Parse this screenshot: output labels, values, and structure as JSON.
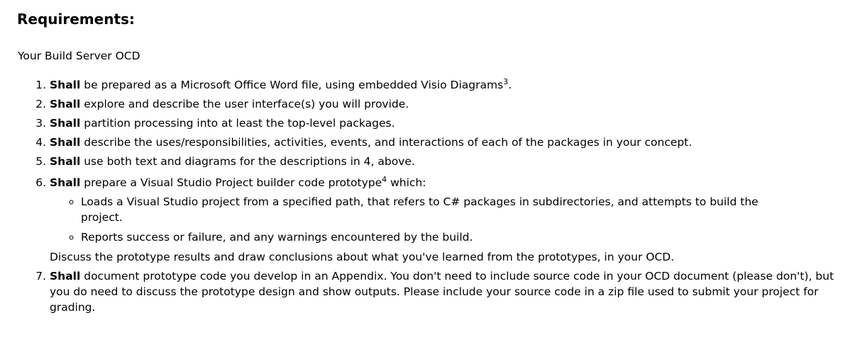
{
  "heading": "Requirements:",
  "intro": "Your Build Server OCD",
  "keyword": "Shall",
  "items": [
    {
      "text": " be prepared as a Microsoft Office Word file, using embedded Visio Diagrams",
      "sup": "3",
      "tail": "."
    },
    {
      "text": " explore and describe the user interface(s) you will provide."
    },
    {
      "text": " partition processing into at least the top-level packages."
    },
    {
      "text": " describe the uses/responsibilities, activities, events, and interactions of each of the packages in your concept."
    },
    {
      "text": " use both text and diagrams for the descriptions in 4, above."
    },
    {
      "text": " prepare a Visual Studio Project builder code prototype",
      "sup": "4",
      "tail": " which:"
    },
    {
      "text": " document prototype code you develop in an Appendix. You don't need to include source code in your OCD document (please don't), but you do need to discuss the prototype design and show outputs. Please include your source code in a zip file used to submit your project for grading."
    }
  ],
  "sub_items": [
    "Loads a Visual Studio project from a specified path, that refers to C# packages in subdirectories, and attempts to build the project.",
    "Reports success or failure, and any warnings encountered by the build."
  ],
  "item6_note": "Discuss the prototype results and draw conclusions about what you've learned from the prototypes, in your OCD."
}
